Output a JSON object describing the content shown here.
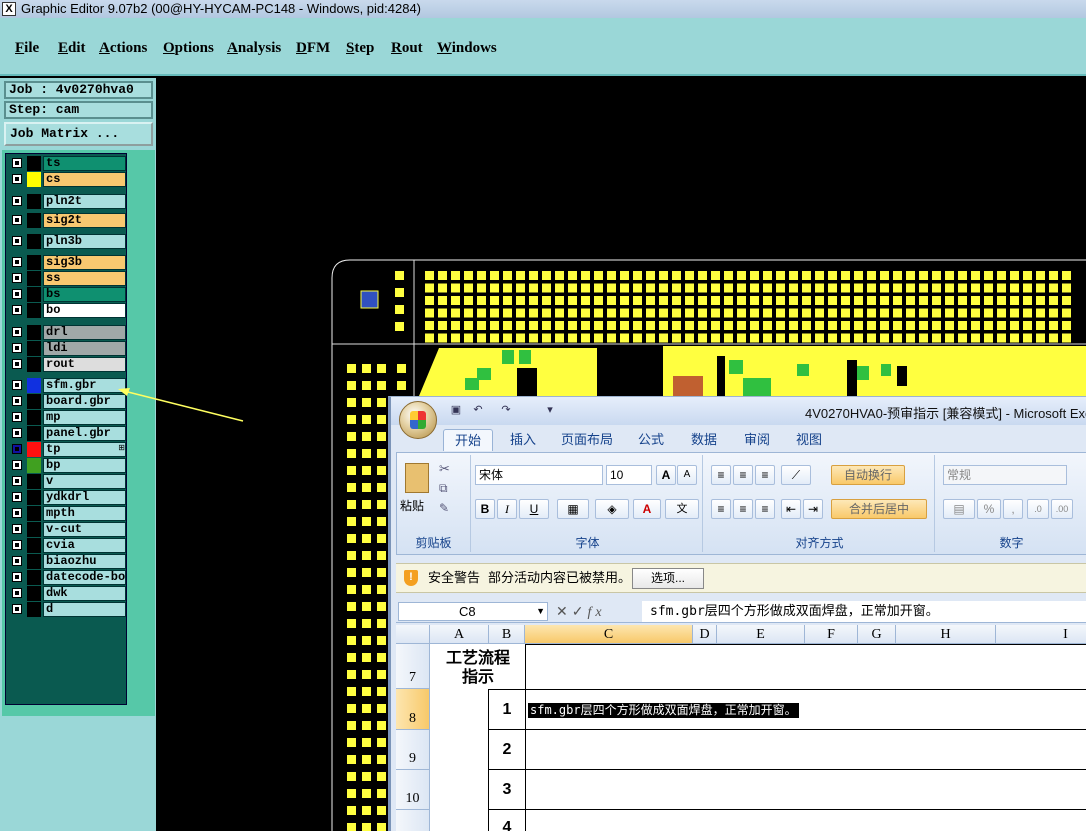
{
  "window": {
    "title": "Graphic Editor 9.07b2 (00@HY-HYCAM-PC148 - Windows, pid:4284)",
    "icon": "X"
  },
  "menu": [
    "File",
    "Edit",
    "Actions",
    "Options",
    "Analysis",
    "DFM",
    "Step",
    "Rout",
    "Windows"
  ],
  "panel": {
    "job": "Job : 4v0270hva0",
    "step": "Step: cam",
    "job_matrix": "Job Matrix ..."
  },
  "layers": [
    {
      "name": "ts",
      "color": "#0f9070",
      "swatch": "#000000"
    },
    {
      "name": "cs",
      "color": "#f8c870",
      "swatch": "#ffff00"
    },
    {
      "name": "pln2t",
      "color": "#a8dede",
      "swatch": "#000000"
    },
    {
      "name": "sig2t",
      "color": "#f8c870",
      "swatch": "#000000"
    },
    {
      "name": "pln3b",
      "color": "#a8dede",
      "swatch": "#000000"
    },
    {
      "name": "sig3b",
      "color": "#f8c870",
      "swatch": "#000000"
    },
    {
      "name": "ss",
      "color": "#f8c870",
      "swatch": "#000000"
    },
    {
      "name": "bs",
      "color": "#0f9070",
      "swatch": "#000000"
    },
    {
      "name": "bo",
      "color": "#ffffff",
      "swatch": "#000000"
    },
    {
      "name": "drl",
      "color": "#a0a8a8",
      "swatch": "#000000"
    },
    {
      "name": "ldi",
      "color": "#a0a8a8",
      "swatch": "#000000"
    },
    {
      "name": "rout",
      "color": "#dddddd",
      "swatch": "#000000"
    },
    {
      "name": "sfm.gbr",
      "color": "#a8dede",
      "swatch": "#1030e0"
    },
    {
      "name": "board.gbr",
      "color": "#a8dede",
      "swatch": "#000000"
    },
    {
      "name": "mp",
      "color": "#a8dede",
      "swatch": "#000000"
    },
    {
      "name": "panel.gbr",
      "color": "#a8dede",
      "swatch": "#000000"
    },
    {
      "name": "tp",
      "color": "#a8dede",
      "swatch": "#ff1010",
      "cb_color": "#1010a0",
      "mark": "⊞"
    },
    {
      "name": "bp",
      "color": "#a8dede",
      "swatch": "#40a020"
    },
    {
      "name": "v",
      "color": "#a8dede",
      "swatch": "#000000"
    },
    {
      "name": "ydkdrl",
      "color": "#a8dede",
      "swatch": "#000000"
    },
    {
      "name": "mpth",
      "color": "#a8dede",
      "swatch": "#000000"
    },
    {
      "name": "v-cut",
      "color": "#a8dede",
      "swatch": "#000000"
    },
    {
      "name": "cvia",
      "color": "#a8dede",
      "swatch": "#000000"
    },
    {
      "name": "biaozhu",
      "color": "#a8dede",
      "swatch": "#000000"
    },
    {
      "name": "datecode-bo",
      "color": "#a8dede",
      "swatch": "#000000"
    },
    {
      "name": "dwk",
      "color": "#a8dede",
      "swatch": "#000000"
    },
    {
      "name": "d",
      "color": "#a8dede",
      "swatch": "#000000"
    }
  ],
  "excel": {
    "title": "4V0270HVA0-预审指示 [兼容模式] - Microsoft Exc",
    "tabs": [
      "开始",
      "插入",
      "页面布局",
      "公式",
      "数据",
      "审阅",
      "视图"
    ],
    "paste": "粘贴",
    "font_name": "宋体",
    "font_size": "10",
    "bold": "B",
    "italic": "I",
    "underline": "U",
    "font_grow": "A",
    "font_shrink": "A",
    "wrap_text": "自动换行",
    "merge_center": "合并后居中",
    "number_format": "常规",
    "percent": "%",
    "comma": ",",
    "groups": [
      "剪贴板",
      "字体",
      "对齐方式",
      "数字"
    ],
    "security_warning": "安全警告",
    "security_message": "部分活动内容已被禁用。",
    "options_button": "选项...",
    "name_box": "C8",
    "formula": "sfm.gbr层四个方形做成双面焊盘，正常加开窗。",
    "columns": [
      "A",
      "B",
      "C",
      "D",
      "E",
      "F",
      "G",
      "H",
      "I"
    ],
    "rows": [
      "7",
      "8",
      "9",
      "10"
    ],
    "cell_a7": "工艺流程指示",
    "cell_b8": "1",
    "cell_b9": "2",
    "cell_b10": "3",
    "cell_b11": "4",
    "cell_c8": "sfm.gbr层四个方形做成双面焊盘，正常加开窗。"
  }
}
